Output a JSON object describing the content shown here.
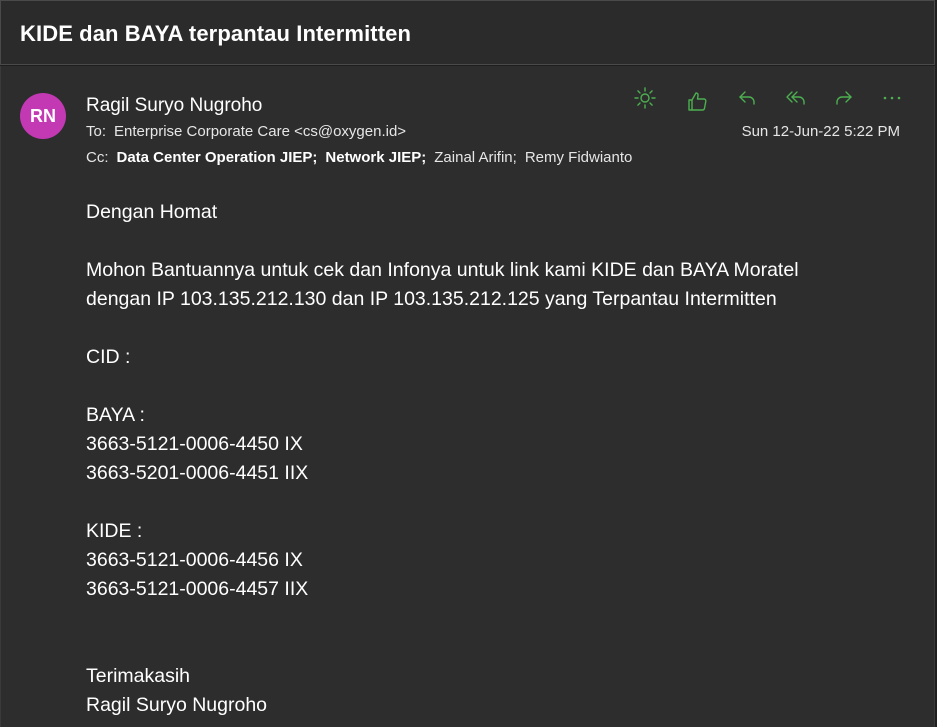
{
  "subject": "KIDE dan BAYA terpantau Intermitten",
  "sender": {
    "initials": "RN",
    "avatar_color": "#c239b3",
    "name": "Ragil Suryo Nugroho"
  },
  "to": {
    "label": "To:",
    "recipient": "Enterprise Corporate Care <cs@oxygen.id>"
  },
  "cc": {
    "label": "Cc:",
    "recipients": [
      "Data Center Operation JIEP;",
      "Network JIEP;",
      "Zainal Arifin;",
      "Remy Fidwianto"
    ]
  },
  "date": "Sun 12-Jun-22 5:22 PM",
  "actions": [
    {
      "icon": "sun-icon"
    },
    {
      "icon": "like-icon"
    },
    {
      "icon": "reply-icon"
    },
    {
      "icon": "reply-all-icon"
    },
    {
      "icon": "forward-icon"
    },
    {
      "icon": "more-icon"
    }
  ],
  "accent_color": "#4caf50",
  "body_lines": [
    "Dengan Homat",
    "",
    "Mohon Bantuannya untuk cek dan Infonya untuk link kami KIDE dan BAYA Moratel",
    "dengan IP 103.135.212.130 dan IP 103.135.212.125 yang Terpantau Intermitten",
    "",
    "CID :",
    "",
    "BAYA :",
    "3663-5121-0006-4450 IX",
    "3663-5201-0006-4451 IIX",
    "",
    "KIDE :",
    "3663-5121-0006-4456 IX",
    "3663-5121-0006-4457 IIX",
    "",
    "",
    "Terimakasih",
    "Ragil Suryo Nugroho"
  ]
}
